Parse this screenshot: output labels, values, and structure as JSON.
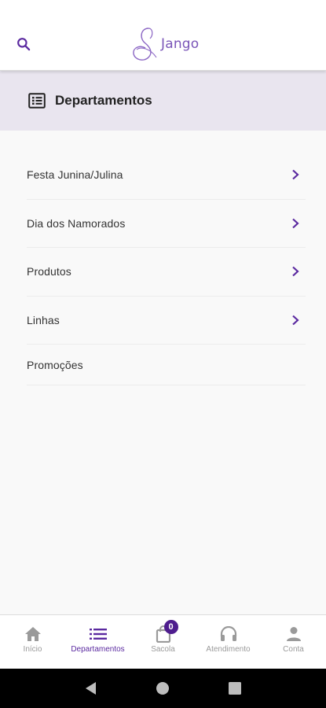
{
  "header": {
    "logo_text": "Jango",
    "search_icon": "search-icon",
    "colors": {
      "accent": "#5b2aa0",
      "logo": "#7a55b8"
    }
  },
  "departments": {
    "title": "Departamentos",
    "icon": "list-box-icon",
    "items": [
      {
        "label": "Festa Junina/Julina",
        "has_children": true
      },
      {
        "label": "Dia dos Namorados",
        "has_children": true
      },
      {
        "label": "Produtos",
        "has_children": true
      },
      {
        "label": "Linhas",
        "has_children": true
      },
      {
        "label": "Promoções",
        "has_children": false
      }
    ]
  },
  "bottom_nav": {
    "items": [
      {
        "label": "Início",
        "icon": "home-icon",
        "active": false
      },
      {
        "label": "Departamentos",
        "icon": "list-icon",
        "active": true
      },
      {
        "label": "Sacola",
        "icon": "bag-icon",
        "active": false,
        "badge": "0"
      },
      {
        "label": "Atendimento",
        "icon": "headphones-icon",
        "active": false
      },
      {
        "label": "Conta",
        "icon": "person-icon",
        "active": false
      }
    ]
  },
  "system_nav": {
    "buttons": [
      "back-icon",
      "home-circle-icon",
      "recents-icon"
    ]
  }
}
